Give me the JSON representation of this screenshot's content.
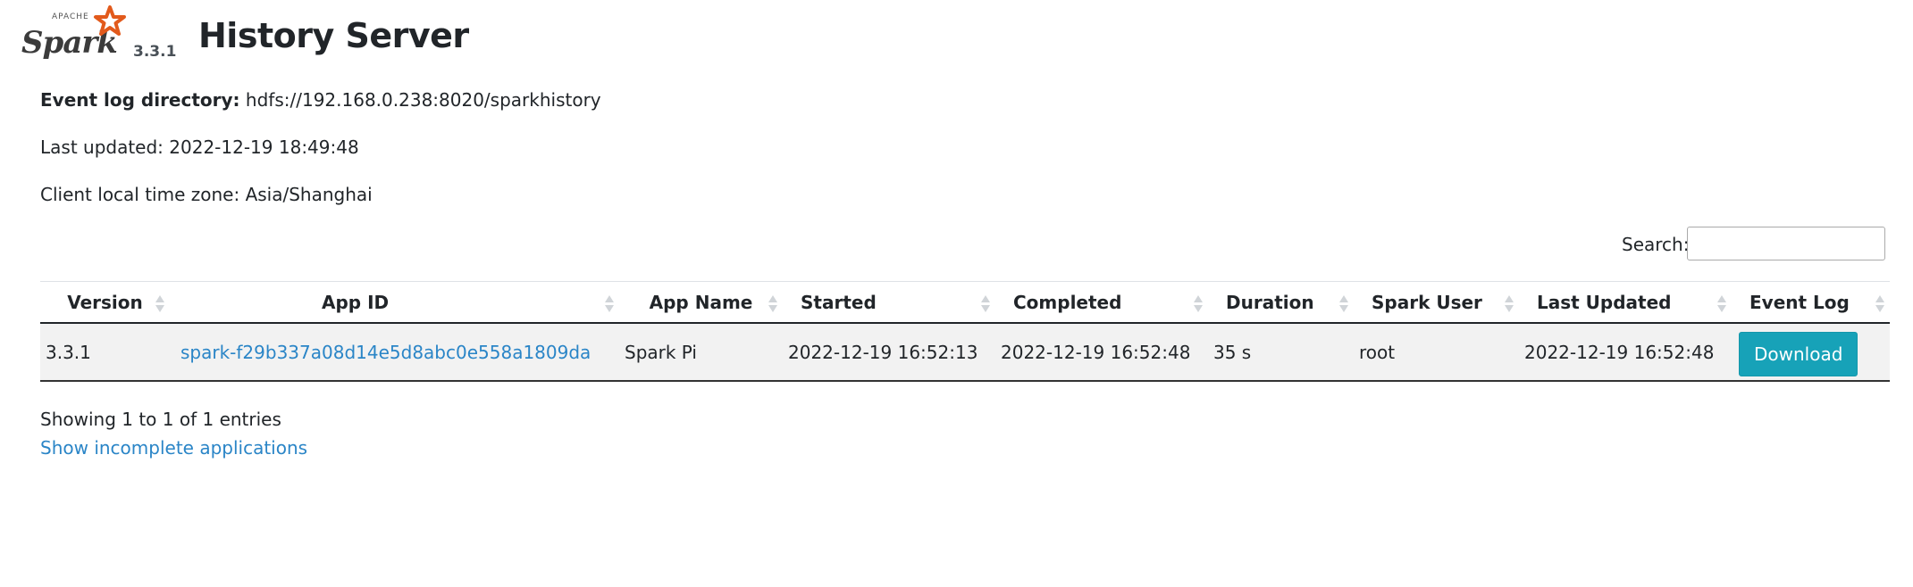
{
  "header": {
    "logo_top": "APACHE",
    "logo_word": "Spark",
    "version": "3.3.1",
    "title": "History Server"
  },
  "info": {
    "event_log_label": "Event log directory:",
    "event_log_value": "hdfs://192.168.0.238:8020/sparkhistory",
    "last_updated": "Last updated: 2022-12-19 18:49:48",
    "time_zone": "Client local time zone: Asia/Shanghai"
  },
  "search": {
    "label": "Search:",
    "value": "",
    "placeholder": ""
  },
  "table": {
    "columns": [
      "Version",
      "App ID",
      "App Name",
      "Started",
      "Completed",
      "Duration",
      "Spark User",
      "Last Updated",
      "Event Log"
    ],
    "rows": [
      {
        "version": "3.3.1",
        "app_id": "spark-f29b337a08d14e5d8abc0e558a1809da",
        "app_name": "Spark Pi",
        "started": "2022-12-19 16:52:13",
        "completed": "2022-12-19 16:52:48",
        "duration": "35 s",
        "spark_user": "root",
        "last_updated": "2022-12-19 16:52:48",
        "event_log": "Download"
      }
    ]
  },
  "footer": {
    "showing": "Showing 1 to 1 of 1 entries",
    "show_incomplete": "Show incomplete applications"
  },
  "colors": {
    "link": "#2a85c7",
    "download_button": "#17a2b8",
    "logo_star": "#e25a1c",
    "row_background": "#f2f2f2"
  },
  "icons": {
    "logo": "spark-logo-icon",
    "sort": "sort-arrows-icon"
  }
}
